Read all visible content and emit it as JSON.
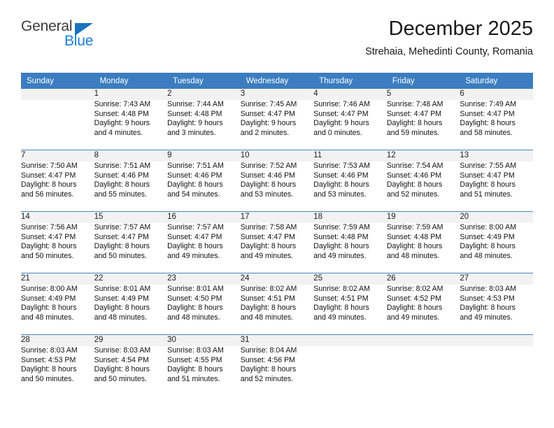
{
  "brand": {
    "name_part1": "General",
    "name_part2": "Blue",
    "colors": {
      "blue": "#1b7fd4",
      "triangle": "#1b72bd",
      "dark": "#3c3c3c"
    }
  },
  "header": {
    "title": "December 2025",
    "subtitle": "Strehaia, Mehedinti County, Romania"
  },
  "calendar": {
    "header_bg": "#3b7dc0",
    "daynum_bg": "#f2f2f2",
    "row_rule": "#4a86c5",
    "weekday_headers": [
      "Sunday",
      "Monday",
      "Tuesday",
      "Wednesday",
      "Thursday",
      "Friday",
      "Saturday"
    ],
    "weeks": [
      [
        {
          "day": "",
          "lines": []
        },
        {
          "day": "1",
          "lines": [
            "Sunrise: 7:43 AM",
            "Sunset: 4:48 PM",
            "Daylight: 9 hours",
            "and 4 minutes."
          ]
        },
        {
          "day": "2",
          "lines": [
            "Sunrise: 7:44 AM",
            "Sunset: 4:48 PM",
            "Daylight: 9 hours",
            "and 3 minutes."
          ]
        },
        {
          "day": "3",
          "lines": [
            "Sunrise: 7:45 AM",
            "Sunset: 4:47 PM",
            "Daylight: 9 hours",
            "and 2 minutes."
          ]
        },
        {
          "day": "4",
          "lines": [
            "Sunrise: 7:46 AM",
            "Sunset: 4:47 PM",
            "Daylight: 9 hours",
            "and 0 minutes."
          ]
        },
        {
          "day": "5",
          "lines": [
            "Sunrise: 7:48 AM",
            "Sunset: 4:47 PM",
            "Daylight: 8 hours",
            "and 59 minutes."
          ]
        },
        {
          "day": "6",
          "lines": [
            "Sunrise: 7:49 AM",
            "Sunset: 4:47 PM",
            "Daylight: 8 hours",
            "and 58 minutes."
          ]
        }
      ],
      [
        {
          "day": "7",
          "lines": [
            "Sunrise: 7:50 AM",
            "Sunset: 4:47 PM",
            "Daylight: 8 hours",
            "and 56 minutes."
          ]
        },
        {
          "day": "8",
          "lines": [
            "Sunrise: 7:51 AM",
            "Sunset: 4:46 PM",
            "Daylight: 8 hours",
            "and 55 minutes."
          ]
        },
        {
          "day": "9",
          "lines": [
            "Sunrise: 7:51 AM",
            "Sunset: 4:46 PM",
            "Daylight: 8 hours",
            "and 54 minutes."
          ]
        },
        {
          "day": "10",
          "lines": [
            "Sunrise: 7:52 AM",
            "Sunset: 4:46 PM",
            "Daylight: 8 hours",
            "and 53 minutes."
          ]
        },
        {
          "day": "11",
          "lines": [
            "Sunrise: 7:53 AM",
            "Sunset: 4:46 PM",
            "Daylight: 8 hours",
            "and 53 minutes."
          ]
        },
        {
          "day": "12",
          "lines": [
            "Sunrise: 7:54 AM",
            "Sunset: 4:46 PM",
            "Daylight: 8 hours",
            "and 52 minutes."
          ]
        },
        {
          "day": "13",
          "lines": [
            "Sunrise: 7:55 AM",
            "Sunset: 4:47 PM",
            "Daylight: 8 hours",
            "and 51 minutes."
          ]
        }
      ],
      [
        {
          "day": "14",
          "lines": [
            "Sunrise: 7:56 AM",
            "Sunset: 4:47 PM",
            "Daylight: 8 hours",
            "and 50 minutes."
          ]
        },
        {
          "day": "15",
          "lines": [
            "Sunrise: 7:57 AM",
            "Sunset: 4:47 PM",
            "Daylight: 8 hours",
            "and 50 minutes."
          ]
        },
        {
          "day": "16",
          "lines": [
            "Sunrise: 7:57 AM",
            "Sunset: 4:47 PM",
            "Daylight: 8 hours",
            "and 49 minutes."
          ]
        },
        {
          "day": "17",
          "lines": [
            "Sunrise: 7:58 AM",
            "Sunset: 4:47 PM",
            "Daylight: 8 hours",
            "and 49 minutes."
          ]
        },
        {
          "day": "18",
          "lines": [
            "Sunrise: 7:59 AM",
            "Sunset: 4:48 PM",
            "Daylight: 8 hours",
            "and 49 minutes."
          ]
        },
        {
          "day": "19",
          "lines": [
            "Sunrise: 7:59 AM",
            "Sunset: 4:48 PM",
            "Daylight: 8 hours",
            "and 48 minutes."
          ]
        },
        {
          "day": "20",
          "lines": [
            "Sunrise: 8:00 AM",
            "Sunset: 4:49 PM",
            "Daylight: 8 hours",
            "and 48 minutes."
          ]
        }
      ],
      [
        {
          "day": "21",
          "lines": [
            "Sunrise: 8:00 AM",
            "Sunset: 4:49 PM",
            "Daylight: 8 hours",
            "and 48 minutes."
          ]
        },
        {
          "day": "22",
          "lines": [
            "Sunrise: 8:01 AM",
            "Sunset: 4:49 PM",
            "Daylight: 8 hours",
            "and 48 minutes."
          ]
        },
        {
          "day": "23",
          "lines": [
            "Sunrise: 8:01 AM",
            "Sunset: 4:50 PM",
            "Daylight: 8 hours",
            "and 48 minutes."
          ]
        },
        {
          "day": "24",
          "lines": [
            "Sunrise: 8:02 AM",
            "Sunset: 4:51 PM",
            "Daylight: 8 hours",
            "and 48 minutes."
          ]
        },
        {
          "day": "25",
          "lines": [
            "Sunrise: 8:02 AM",
            "Sunset: 4:51 PM",
            "Daylight: 8 hours",
            "and 49 minutes."
          ]
        },
        {
          "day": "26",
          "lines": [
            "Sunrise: 8:02 AM",
            "Sunset: 4:52 PM",
            "Daylight: 8 hours",
            "and 49 minutes."
          ]
        },
        {
          "day": "27",
          "lines": [
            "Sunrise: 8:03 AM",
            "Sunset: 4:53 PM",
            "Daylight: 8 hours",
            "and 49 minutes."
          ]
        }
      ],
      [
        {
          "day": "28",
          "lines": [
            "Sunrise: 8:03 AM",
            "Sunset: 4:53 PM",
            "Daylight: 8 hours",
            "and 50 minutes."
          ]
        },
        {
          "day": "29",
          "lines": [
            "Sunrise: 8:03 AM",
            "Sunset: 4:54 PM",
            "Daylight: 8 hours",
            "and 50 minutes."
          ]
        },
        {
          "day": "30",
          "lines": [
            "Sunrise: 8:03 AM",
            "Sunset: 4:55 PM",
            "Daylight: 8 hours",
            "and 51 minutes."
          ]
        },
        {
          "day": "31",
          "lines": [
            "Sunrise: 8:04 AM",
            "Sunset: 4:56 PM",
            "Daylight: 8 hours",
            "and 52 minutes."
          ]
        },
        {
          "day": "",
          "lines": []
        },
        {
          "day": "",
          "lines": []
        },
        {
          "day": "",
          "lines": []
        }
      ]
    ]
  }
}
